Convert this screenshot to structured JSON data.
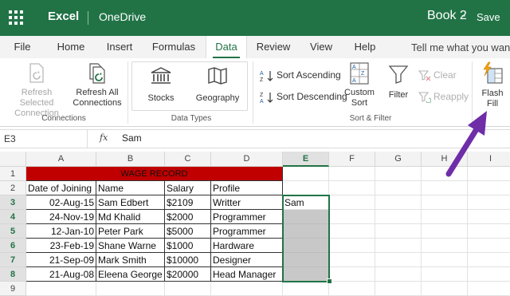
{
  "app": {
    "name": "Excel",
    "service": "OneDrive",
    "book_title": "Book 2",
    "dash": "-",
    "save_label": "Save"
  },
  "tabs": [
    "File",
    "Home",
    "Insert",
    "Formulas",
    "Data",
    "Review",
    "View",
    "Help"
  ],
  "active_tab": "Data",
  "tell_me": "Tell me what you want",
  "ribbon": {
    "refresh_selected": "Refresh Selected Connection",
    "refresh_all": "Refresh All Connections",
    "connections_group": "Connections",
    "stocks": "Stocks",
    "geography": "Geography",
    "data_types_group": "Data Types",
    "sort_ascending": "Sort Ascending",
    "sort_descending": "Sort Descending",
    "custom_sort": "Custom Sort",
    "filter": "Filter",
    "clear": "Clear",
    "reapply": "Reapply",
    "sort_filter_group": "Sort & Filter",
    "flash_fill": "Flash Fill"
  },
  "formula_bar": {
    "cell_ref": "E3",
    "fx": "fx",
    "value": "Sam"
  },
  "columns": [
    "A",
    "B",
    "C",
    "D",
    "E",
    "F",
    "G",
    "H",
    "I"
  ],
  "selected_column": "E",
  "rows": [
    "1",
    "2",
    "3",
    "4",
    "5",
    "6",
    "7",
    "8",
    "9"
  ],
  "sheet": {
    "title": "WAGE RECORD",
    "headers": [
      "Date of Joining",
      "Name",
      "Salary",
      "Profile"
    ],
    "records": [
      [
        "02-Aug-15",
        "Sam Edbert",
        "$2109",
        "Writter",
        "Sam"
      ],
      [
        "24-Nov-19",
        "Md Khalid",
        "$2000",
        "Programmer",
        ""
      ],
      [
        "12-Jan-10",
        "Peter Park",
        "$5000",
        "Programmer",
        ""
      ],
      [
        "23-Feb-19",
        "Shane Warne",
        "$1000",
        "Hardware",
        ""
      ],
      [
        "21-Sep-09",
        "Mark Smith",
        "$10000",
        "Designer",
        ""
      ],
      [
        "21-Aug-08",
        "Eleena George",
        "$20000",
        "Head Manager",
        ""
      ]
    ]
  },
  "colors": {
    "brand": "#217346",
    "title_fill": "#c00000",
    "arrow": "#6f2da8",
    "fill_range": "#c8c8c8"
  }
}
